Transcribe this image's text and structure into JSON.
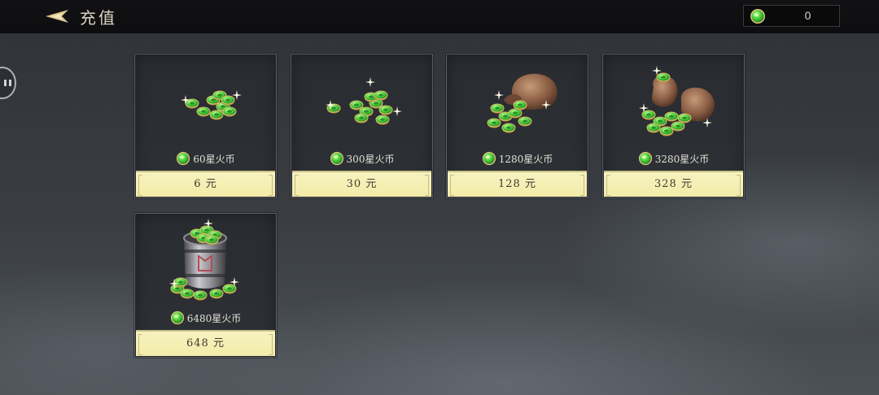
{
  "header": {
    "title": "充值",
    "balance": "0"
  },
  "packages": [
    {
      "amount": "60星火币",
      "price": "6 元"
    },
    {
      "amount": "300星火币",
      "price": "30 元"
    },
    {
      "amount": "1280星火币",
      "price": "128 元"
    },
    {
      "amount": "3280星火币",
      "price": "328 元"
    },
    {
      "amount": "6480星火币",
      "price": "648 元"
    }
  ],
  "colors": {
    "coin_green": "#5fcf4a",
    "price_bar": "#f5efb4",
    "topbar": "#0f0f11"
  },
  "icons": {
    "back": "back-arrow-icon",
    "currency": "jade-coin-icon",
    "art": [
      "coin-pile-small",
      "coin-pile-medium",
      "coin-bag",
      "coin-bags",
      "coin-barrel"
    ]
  }
}
